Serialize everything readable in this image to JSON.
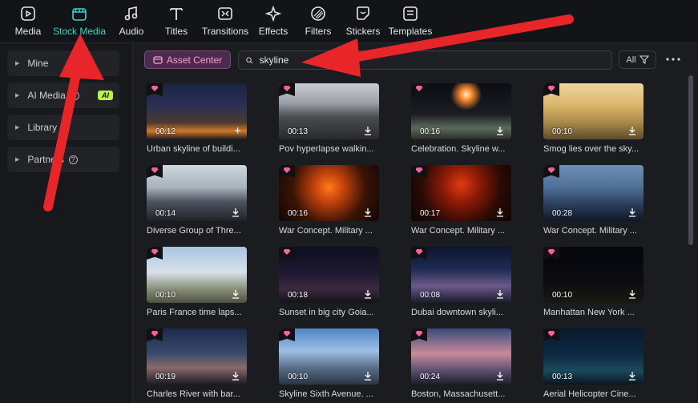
{
  "tabs": [
    {
      "label": "Media",
      "icon": "media-icon"
    },
    {
      "label": "Stock Media",
      "icon": "stock-media-icon",
      "active": true
    },
    {
      "label": "Audio",
      "icon": "music-note-icon"
    },
    {
      "label": "Titles",
      "icon": "text-t-icon"
    },
    {
      "label": "Transitions",
      "icon": "transitions-icon"
    },
    {
      "label": "Effects",
      "icon": "effects-sparkle-icon"
    },
    {
      "label": "Filters",
      "icon": "filters-icon"
    },
    {
      "label": "Stickers",
      "icon": "sticker-icon"
    },
    {
      "label": "Templates",
      "icon": "templates-icon"
    }
  ],
  "sidebar": {
    "items": [
      {
        "label": "Mine"
      },
      {
        "label": "AI Media",
        "badge": "AI"
      },
      {
        "label": "Library"
      },
      {
        "label": "Partners"
      }
    ]
  },
  "toolbar": {
    "asset_center_label": "Asset Center",
    "search_value": "skyline",
    "filter_label": "All"
  },
  "colors": {
    "accent": "#38d5c4",
    "premium": "#ff5fa2",
    "annotation_arrow": "#e8262a"
  },
  "grid": [
    {
      "title": "Urban skyline of buildi...",
      "duration": "00:12",
      "action": "add"
    },
    {
      "title": "Pov hyperlapse walkin...",
      "duration": "00:13",
      "action": "download"
    },
    {
      "title": "Celebration. Skyline w...",
      "duration": "00:16",
      "action": "download"
    },
    {
      "title": "Smog lies over the sky...",
      "duration": "00:10",
      "action": "download"
    },
    {
      "title": "Diverse Group of Thre...",
      "duration": "00:14",
      "action": "download"
    },
    {
      "title": "War Concept. Military ...",
      "duration": "00:16",
      "action": "download"
    },
    {
      "title": "War Concept. Military ...",
      "duration": "00:17",
      "action": "download"
    },
    {
      "title": "War Concept. Military ...",
      "duration": "00:28",
      "action": "download"
    },
    {
      "title": "Paris France time laps...",
      "duration": "00:10",
      "action": "download"
    },
    {
      "title": "Sunset in big city Goia...",
      "duration": "00:18",
      "action": "download"
    },
    {
      "title": "Dubai downtown skyli...",
      "duration": "00:08",
      "action": "download"
    },
    {
      "title": "Manhattan New York ...",
      "duration": "00:10",
      "action": "download"
    },
    {
      "title": "Charles River with bar...",
      "duration": "00:19",
      "action": "download"
    },
    {
      "title": "Skyline Sixth Avenue. ...",
      "duration": "00:10",
      "action": "download"
    },
    {
      "title": "Boston, Massachusett...",
      "duration": "00:24",
      "action": "download"
    },
    {
      "title": "Aerial Helicopter Cine...",
      "duration": "00:13",
      "action": "download"
    }
  ]
}
